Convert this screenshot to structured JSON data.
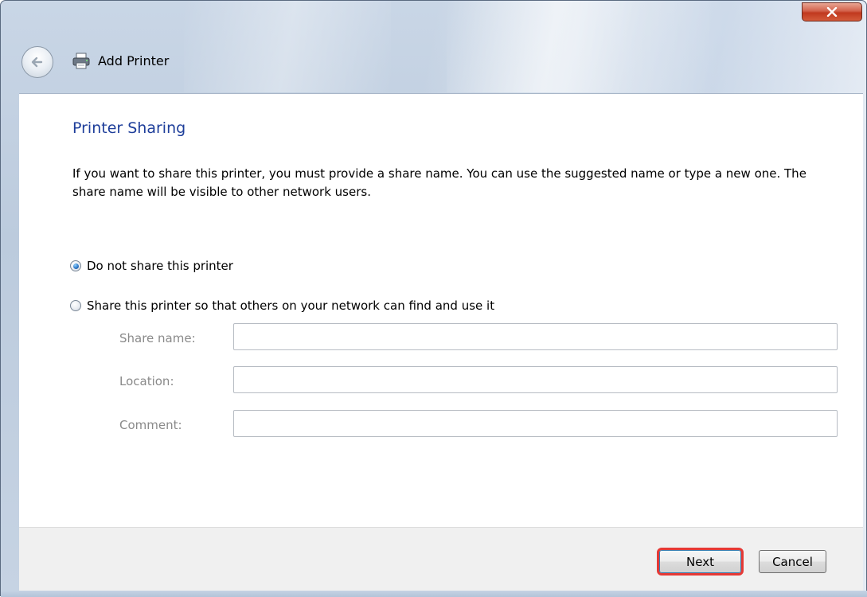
{
  "window": {
    "title": "Add Printer",
    "close_symbol": "✕"
  },
  "page": {
    "heading": "Printer Sharing",
    "description": "If you want to share this printer, you must provide a share name. You can use the suggested name or type a new one. The share name will be visible to other network users."
  },
  "sharing_options": [
    {
      "label": "Do not share this printer",
      "selected": true
    },
    {
      "label": "Share this printer so that others on your network can find and use it",
      "selected": false
    }
  ],
  "fields": {
    "share_name": {
      "label": "Share name:",
      "value": ""
    },
    "location": {
      "label": "Location:",
      "value": ""
    },
    "comment": {
      "label": "Comment:",
      "value": ""
    }
  },
  "footer": {
    "next_label": "Next",
    "cancel_label": "Cancel"
  },
  "icons": {
    "back": "back-arrow-icon",
    "printer": "printer-icon",
    "close": "close-icon"
  },
  "colors": {
    "heading": "#1e3e9a",
    "highlight_outline": "#e53935",
    "close_button": "#c0391f"
  }
}
